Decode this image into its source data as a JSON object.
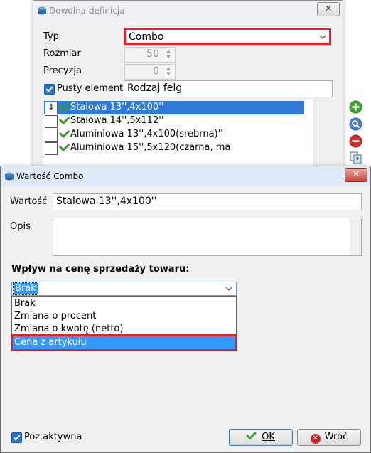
{
  "back_window": {
    "title": "Dowolna definicja",
    "type_label": "Typ",
    "type_value": "Combo",
    "size_label": "Rozmiar",
    "size_value": "50",
    "precision_label": "Precyzja",
    "precision_value": "0",
    "empty_element_label": "Pusty element",
    "empty_element_value": "Rodzaj felg",
    "items": [
      {
        "label": "Stalowa 13'',4x100''",
        "selected": true
      },
      {
        "label": "Stalowa 14'',5x112''",
        "selected": false
      },
      {
        "label": "Aluminiowa 13'',4x100(srebrna)''",
        "selected": false
      },
      {
        "label": "Aluminiowa 15'',5x120(czarna, ma",
        "selected": false
      }
    ],
    "side_buttons": [
      "add-icon",
      "edit-icon",
      "remove-icon",
      "copy-icon"
    ]
  },
  "dialog": {
    "title": "Wartość Combo",
    "value_label": "Wartość",
    "value_text": "Stalowa 13'',4x100''",
    "description_label": "Opis",
    "description_text": "",
    "price_section_label": "Wpływ na cenę sprzedaży towaru:",
    "price_selected": "Brak",
    "price_options": [
      "Brak",
      "Zmiana o procent",
      "Zmiana o kwotę (netto)",
      "Cena z artykułu"
    ],
    "active_label": "Poz.aktywna",
    "ok_label": "OK",
    "cancel_label": "Wróć"
  },
  "colors": {
    "highlight": "#3399ff",
    "selection_blue": "#2f7ad6",
    "red_annotation": "#e0202a",
    "ok_green": "#3aa52c",
    "cancel_red": "#c8242b"
  }
}
